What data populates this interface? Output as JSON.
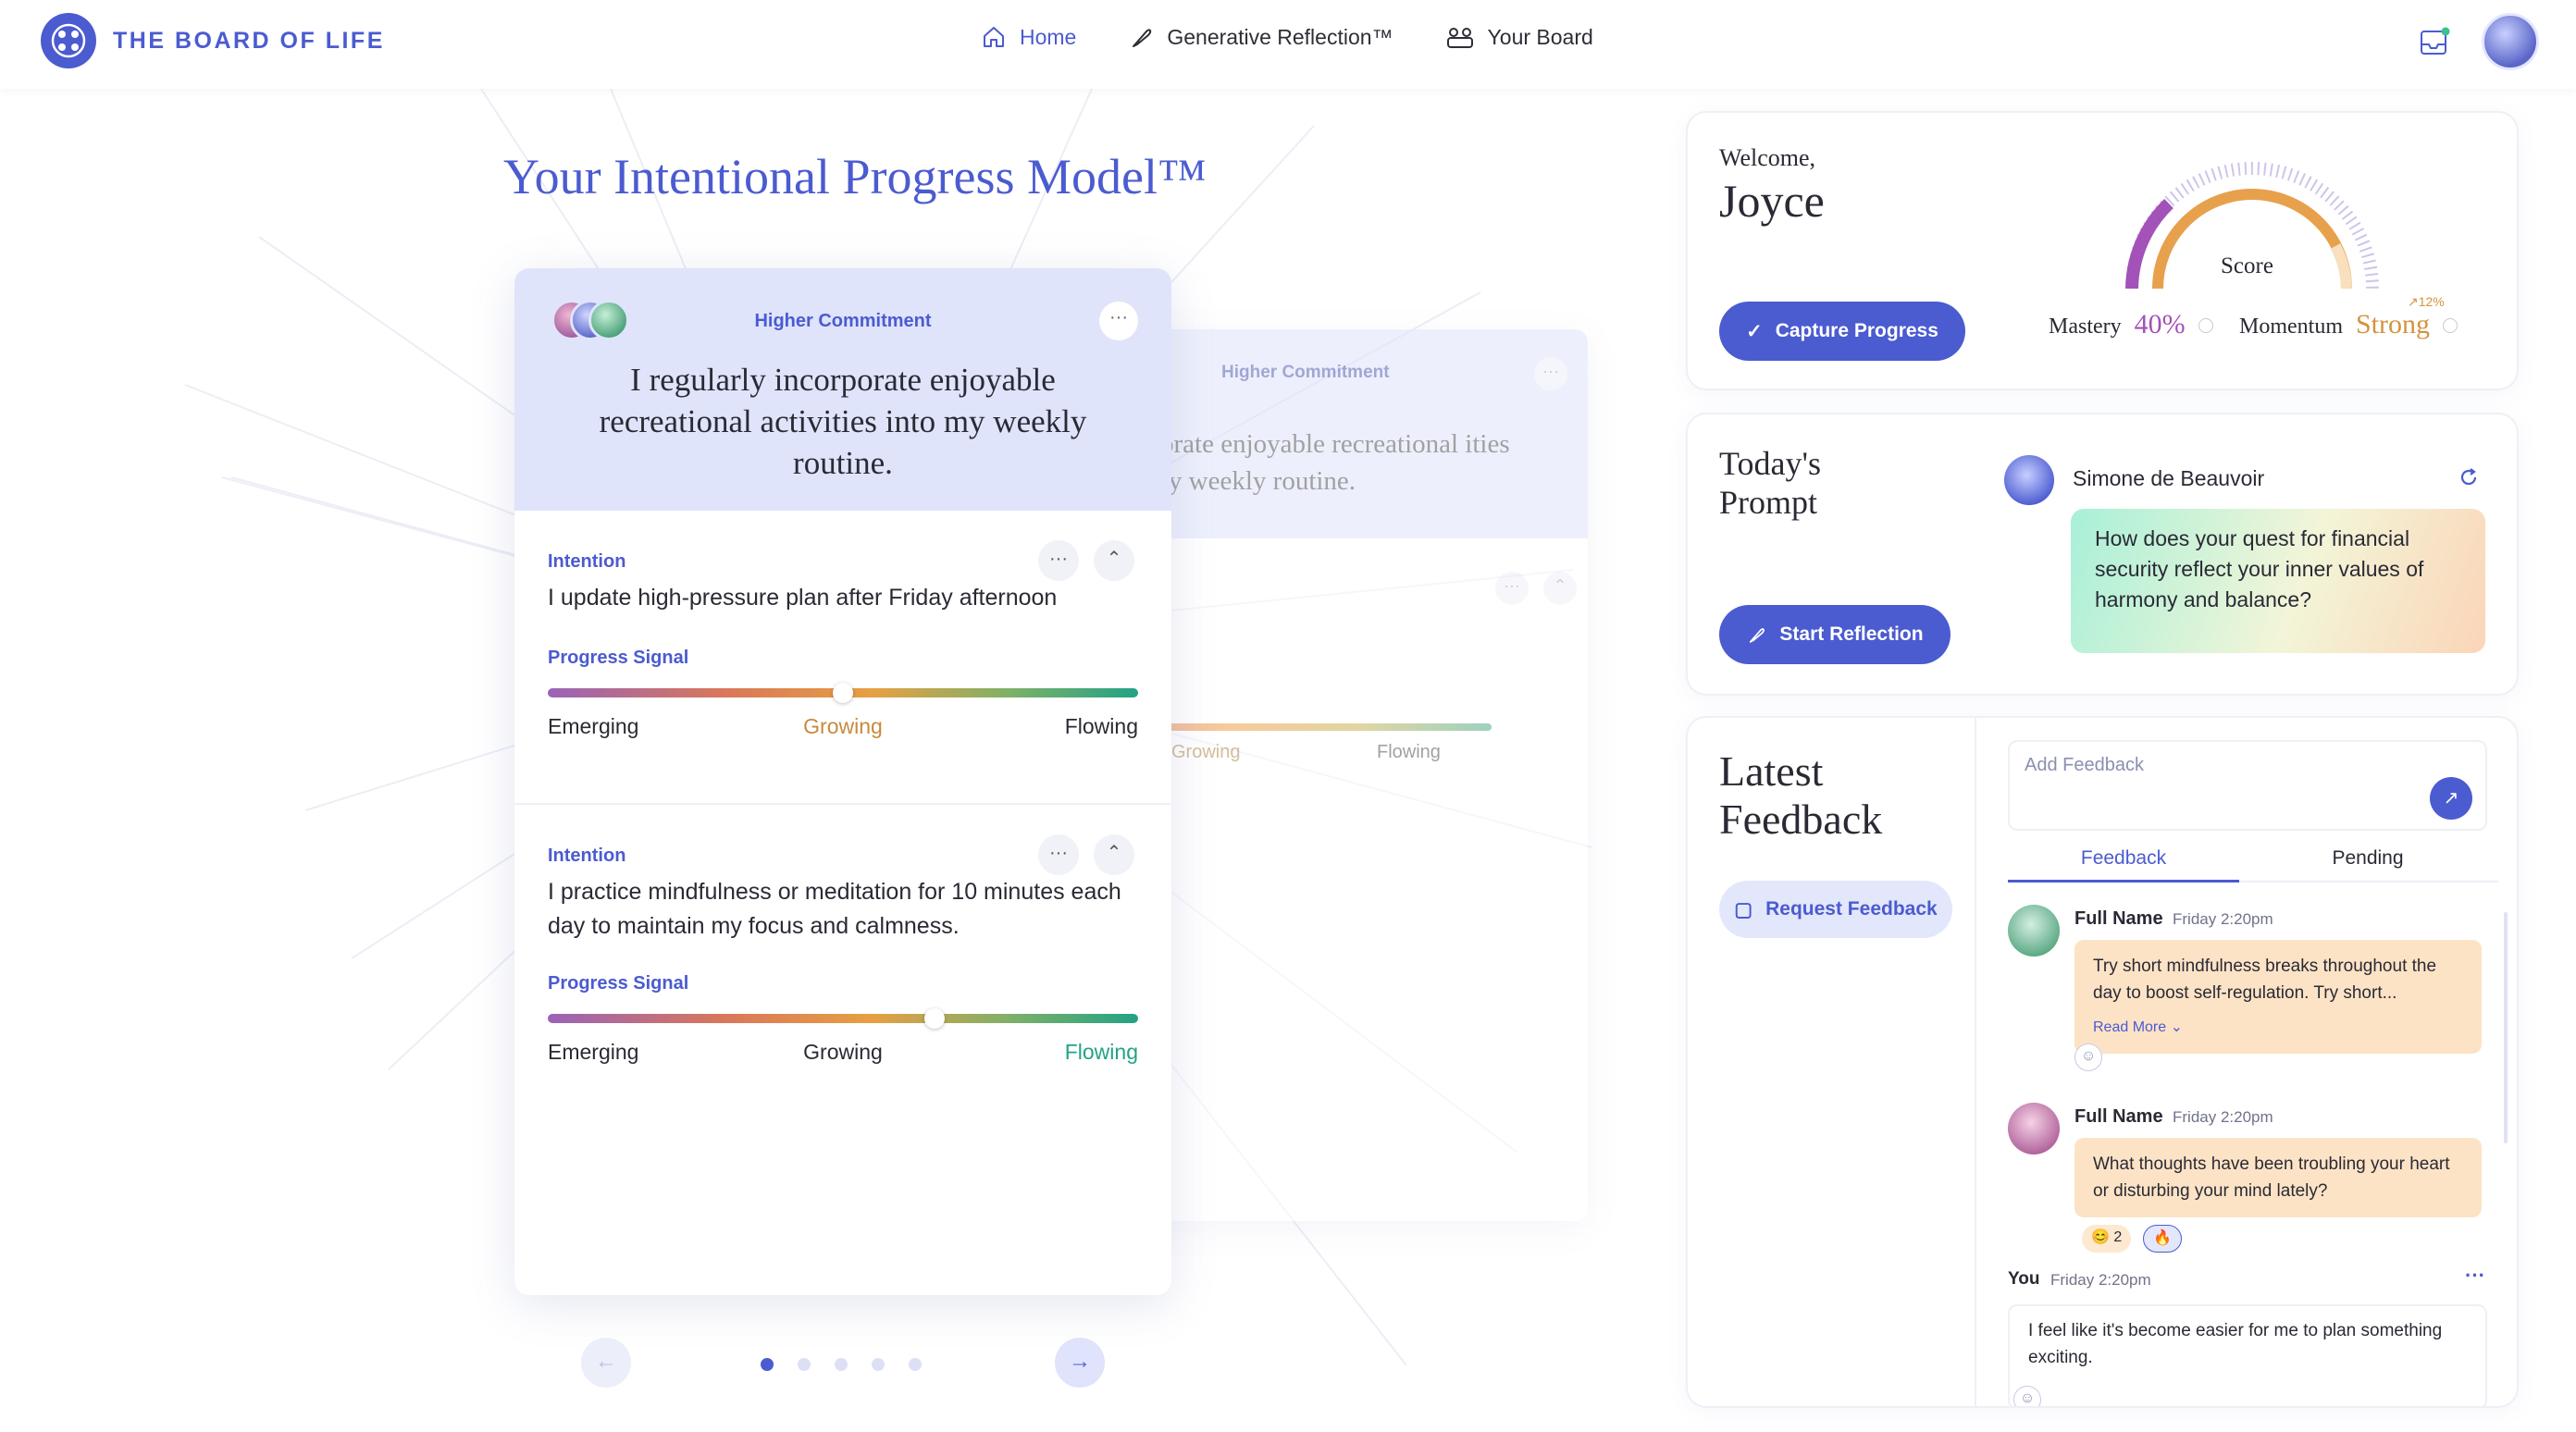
{
  "header": {
    "brand": "THE BOARD OF LIFE",
    "nav": [
      {
        "label": "Home",
        "icon": "home-icon"
      },
      {
        "label": "Generative Reflection™",
        "icon": "feather-icon"
      },
      {
        "label": "Your Board",
        "icon": "board-icon"
      }
    ],
    "accent_color": "#4b5bd0"
  },
  "main": {
    "title": "Your Intentional Progress Model™",
    "front_card": {
      "label": "Higher Commitment",
      "quote": "I regularly incorporate enjoyable recreational activities into my weekly routine.",
      "intentions": [
        {
          "label": "Intention",
          "text": "I update high-pressure plan after Friday afternoon",
          "signal_label": "Progress Signal",
          "signal_value": 0.5,
          "stages": [
            "Emerging",
            "Growing",
            "Flowing"
          ],
          "active_stage": "Growing"
        },
        {
          "label": "Intention",
          "text": "I practice mindfulness or meditation for 10 minutes each day to maintain my focus and calmness.",
          "signal_label": "Progress Signal",
          "signal_value": 0.655,
          "stages": [
            "Emerging",
            "Growing",
            "Flowing"
          ],
          "active_stage": "Flowing"
        }
      ]
    },
    "back_card": {
      "label": "Higher Commitment",
      "quote": "ncorporate enjoyable recreational ities into my weekly routine.",
      "partial_label": "on",
      "stage_growing": "Growing",
      "stage_flowing": "Flowing"
    },
    "pager": {
      "pages": 5,
      "current": 1
    }
  },
  "welcome": {
    "greeting": "Welcome,",
    "name": "Joyce",
    "capture_label": "Capture Progress",
    "score_label": "Score",
    "mastery_label": "Mastery",
    "mastery_value": "40%",
    "momentum_label": "Momentum",
    "momentum_value": "Strong",
    "momentum_change": "↗12%"
  },
  "prompt": {
    "title": "Today's Prompt",
    "start_label": "Start Reflection",
    "author": "Simone de Beauvoir",
    "question": "How does your quest for financial security reflect your inner values of harmony and balance?"
  },
  "feedback": {
    "title": "Latest Feedback",
    "request_label": "Request Feedback",
    "input_placeholder": "Add Feedback",
    "tabs": [
      "Feedback",
      "Pending"
    ],
    "items": [
      {
        "name": "Full Name",
        "time": "Friday 2:20pm",
        "text": "Try short mindfulness breaks throughout the day to boost self-regulation. Try short...",
        "read_more": "Read More"
      },
      {
        "name": "Full Name",
        "time": "Friday 2:20pm",
        "text": "What thoughts have been troubling your heart or disturbing your mind lately?",
        "reaction_count": "2"
      }
    ],
    "you": {
      "label": "You",
      "time": "Friday 2:20pm",
      "text": "I feel like it's become easier for me to plan something exciting."
    }
  }
}
